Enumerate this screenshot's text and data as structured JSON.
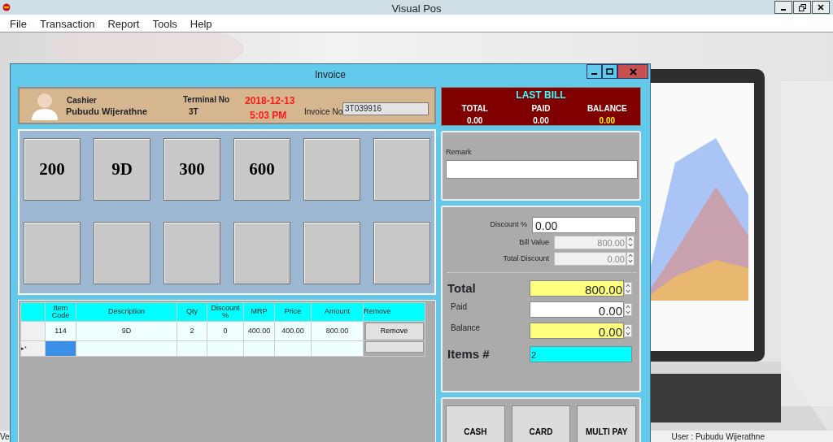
{
  "app": {
    "title": "Visual Pos",
    "menu": [
      "File",
      "Transaction",
      "Report",
      "Tools",
      "Help"
    ]
  },
  "invoice": {
    "title": "Invoice",
    "header": {
      "cashier_label": "Cashier",
      "cashier_name": "Pubudu Wijerathne",
      "terminal_label": "Terminal No",
      "terminal_no": "3T",
      "date": "2018-12-13",
      "time": "5:03 PM",
      "invoice_label": "Invoice No",
      "invoice_no": "3T039916"
    },
    "quick_items": [
      {
        "kind": "item",
        "label": "200"
      },
      {
        "kind": "item",
        "label": "9D"
      },
      {
        "kind": "item",
        "label": "300"
      },
      {
        "kind": "item",
        "label": "600"
      },
      {
        "kind": "blank"
      },
      {
        "kind": "blank"
      },
      {
        "kind": "blank"
      },
      {
        "kind": "blank"
      },
      {
        "kind": "blank"
      },
      {
        "kind": "blank"
      },
      {
        "kind": "blank"
      },
      {
        "kind": "blank"
      }
    ],
    "table": {
      "columns": [
        "Item Code",
        "Description",
        "Qty",
        "Discount %",
        "MRP",
        "Price",
        "Amount",
        "Remove"
      ],
      "rows": [
        {
          "cells": [
            "114",
            "9D",
            "2",
            "0",
            "400.00",
            "400.00",
            "800.00"
          ],
          "button": "Remove"
        }
      ],
      "new_row": {
        "marker": "▸*",
        "code_selected": true
      }
    },
    "last_bill": {
      "title": "LAST BILL",
      "total_label": "TOTAL",
      "total": "0.00",
      "paid_label": "PAID",
      "paid": "0.00",
      "balance_label": "BALANCE",
      "balance": "0.00"
    },
    "remark": {
      "label": "Remark"
    },
    "discount_fields": [
      {
        "label": "Discount %",
        "value": "0.00",
        "kind": "input",
        "disabled": false
      },
      {
        "label": "Bill Value",
        "value": "800.00",
        "kind": "spin",
        "disabled": true
      },
      {
        "label": "Total Discount",
        "value": "0.00",
        "kind": "spin",
        "disabled": true
      }
    ],
    "summary_fields": [
      {
        "label": "Total",
        "value": "800.00",
        "kind": "spin",
        "emphasis": true,
        "color": "#ffff80"
      },
      {
        "label": "Paid",
        "value": "0.00",
        "kind": "spin",
        "emphasis": false,
        "color": "#ffffff"
      },
      {
        "label": "Balance",
        "value": "0.00",
        "kind": "spin",
        "emphasis": false,
        "color": "#ffff80"
      },
      {
        "label": "Items #",
        "value": "2",
        "kind": "input",
        "emphasis": true,
        "color": "#00ffff"
      }
    ],
    "payment_buttons": [
      "CASH",
      "CARD",
      "MULTI PAY"
    ]
  },
  "status_bar": {
    "left": "Ve",
    "user": "User : Pubudu Wijerathne"
  }
}
